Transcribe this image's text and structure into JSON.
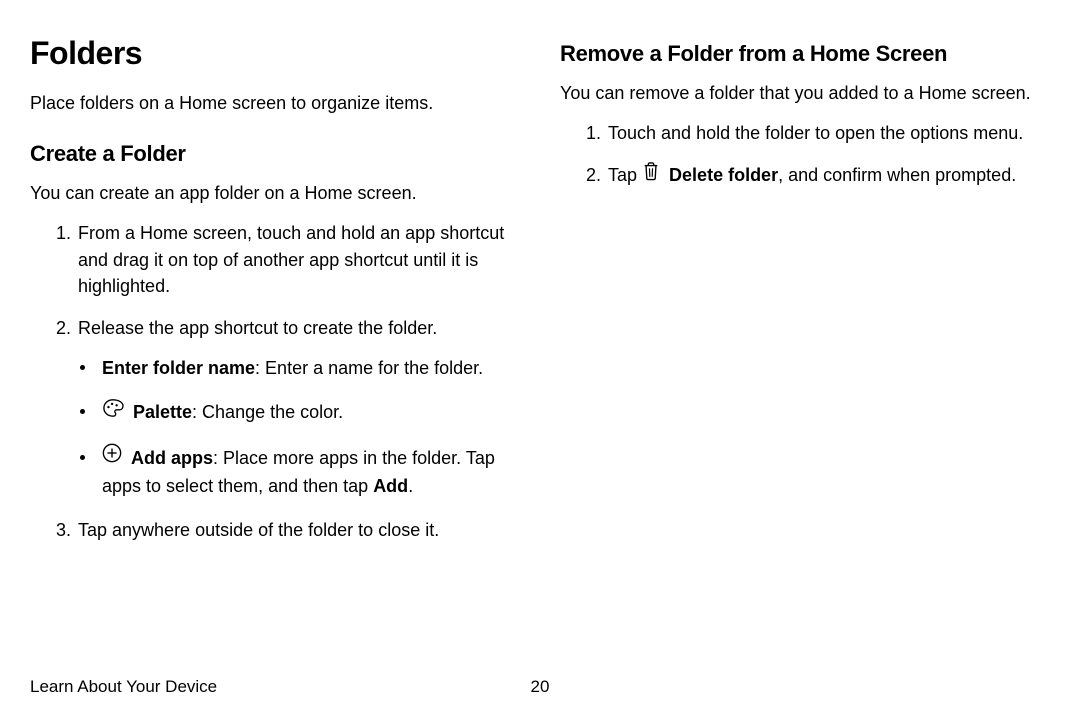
{
  "left": {
    "heading": "Folders",
    "intro": "Place folders on a Home screen to organize items.",
    "sub1": "Create a Folder",
    "sub1_intro": "You can create an app folder on a Home screen.",
    "step1": "From a Home screen, touch and hold an app shortcut and drag it on top of another app shortcut until it is highlighted.",
    "step2": "Release the app shortcut to create the folder.",
    "b_enter_name": "Enter folder name",
    "b_enter_name_rest": ": Enter a name for the folder.",
    "b_palette": "Palette",
    "b_palette_rest": ": Change the color.",
    "b_addapps": "Add apps",
    "b_addapps_rest_1": ": Place more apps in the folder. Tap apps to select them, and then tap ",
    "b_addapps_add": "Add",
    "b_addapps_rest_2": ".",
    "step3": "Tap anywhere outside of the folder to close it."
  },
  "right": {
    "sub2": "Remove a Folder from a Home Screen",
    "sub2_intro": "You can remove a folder that you added to a Home screen.",
    "r_step1": "Touch and hold the folder to open the options menu.",
    "r_step2_pre": "Tap ",
    "r_delete_label": "Delete folder",
    "r_step2_post": ", and confirm when prompted."
  },
  "footer": {
    "section": "Learn About Your Device",
    "page": "20"
  }
}
